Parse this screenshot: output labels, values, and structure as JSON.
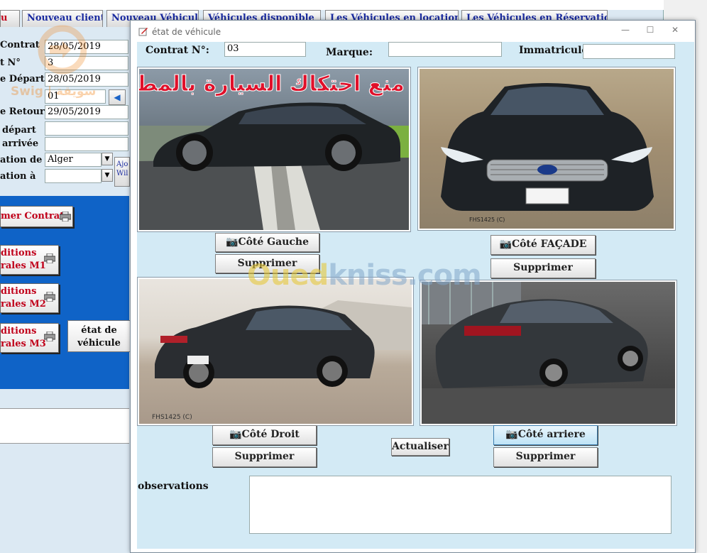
{
  "background_window": {
    "tabs": [
      {
        "label": "u"
      },
      {
        "label": "Nouveau client"
      },
      {
        "label": "Nouveau Véhicule"
      },
      {
        "label": "Véhicules disponible"
      },
      {
        "label": "Les Véhicules en location"
      },
      {
        "label": "Les Véhicules en Réservation"
      }
    ],
    "fields": [
      {
        "label": "Contrat",
        "value": "28/05/2019"
      },
      {
        "label": "t N°",
        "value": "3"
      },
      {
        "label": "e Départ",
        "value": "28/05/2019"
      },
      {
        "label": "",
        "value": "01"
      },
      {
        "label": "e Retour",
        "value": "29/05/2019"
      },
      {
        "label": "départ",
        "value": ""
      },
      {
        "label": "arrivée",
        "value": ""
      },
      {
        "label": "ation de",
        "value": "Alger"
      },
      {
        "label": "ation à",
        "value": ""
      }
    ],
    "side_button": "Ajo Wil",
    "buttons": {
      "imprimer_contrat": "mer Contrat",
      "conditions_m1_line1": "ditions",
      "conditions_m1_line2": "rales M1",
      "conditions_m2_line1": "ditions",
      "conditions_m2_line2": "rales M2",
      "conditions_m3_line1": "ditions",
      "conditions_m3_line2": "rales M3",
      "etat_vehicule_line1": "état de",
      "etat_vehicule_line2": "véhicule"
    },
    "logo_text": "Swig | سويقة"
  },
  "dialog": {
    "title": "état de véhicule",
    "controls": {
      "minimize": "—",
      "maximize": "☐",
      "close": "✕"
    },
    "header": {
      "contrat_label": "Contrat N°:",
      "contrat_value": "03",
      "marque_label": "Marque:",
      "marque_value": "",
      "immatricule_label": "Immatricule:",
      "immatricule_value": ""
    },
    "photos": {
      "left": {
        "button": "Côté Gauche",
        "delete": "Supprimer",
        "overlay_text": "منع احتكاك السيارة بالمطبات"
      },
      "front": {
        "button": "Côté FAÇADE",
        "delete": "Supprimer",
        "plate_text": "FHS1425 (C)"
      },
      "right": {
        "button": "Côté Droit",
        "delete": "Supprimer",
        "plate_text": "FHS1425 (C)"
      },
      "rear": {
        "button": "Côté arriere",
        "delete": "Supprimer"
      }
    },
    "actualiser": "Actualiser",
    "observations_label": "observations",
    "observations_value": ""
  },
  "watermark": {
    "prefix": "Oued",
    "suffix": "kniss.com"
  },
  "colors": {
    "dialog_bg": "#d3eaf5",
    "blue_panel": "#0f63c7",
    "tab_text": "#1a2ba0",
    "red_text": "#c0001a",
    "overlay_red": "#e0102a"
  }
}
